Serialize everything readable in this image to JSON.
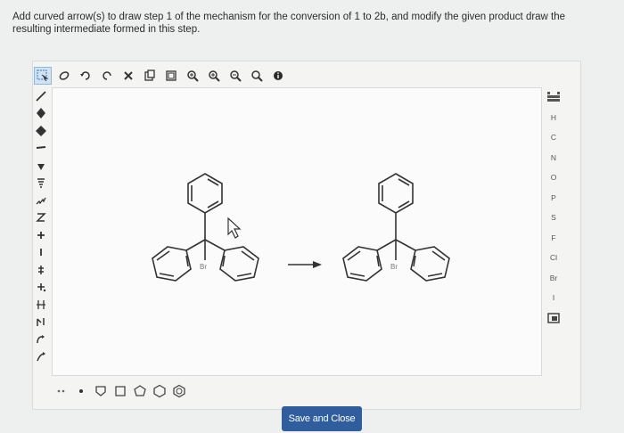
{
  "question": {
    "text": "Add curved arrow(s) to draw step 1 of the mechanism for the conversion of 1 to 2b, and modify the given product draw the resulting intermediate formed in this step."
  },
  "toolbar": {
    "tools": [
      {
        "name": "select-tool",
        "glyph": "⬚",
        "active": true
      },
      {
        "name": "eraser-icon",
        "glyph": "⌀"
      },
      {
        "name": "undo-icon",
        "glyph": "↶"
      },
      {
        "name": "redo-icon",
        "glyph": "↷"
      },
      {
        "name": "delete-icon",
        "glyph": "✕"
      },
      {
        "name": "copy-icon",
        "glyph": "⧉"
      },
      {
        "name": "paste-icon",
        "glyph": "⧉"
      },
      {
        "name": "zoom-in-icon",
        "glyph": "⊕"
      },
      {
        "name": "zoom-fit-icon",
        "glyph": "⊕"
      },
      {
        "name": "zoom-out-icon",
        "glyph": "⊖"
      },
      {
        "name": "zoom-reset-icon",
        "glyph": "⊙"
      },
      {
        "name": "info-icon",
        "glyph": "●"
      }
    ]
  },
  "left_tools": [
    {
      "name": "single-bond-tool",
      "glyph": "╱"
    },
    {
      "name": "double-bond-tool",
      "glyph": "◆"
    },
    {
      "name": "triple-bond-tool",
      "glyph": "◆"
    },
    {
      "name": "chain-tool",
      "glyph": "▬"
    },
    {
      "name": "wedge-bond-tool",
      "glyph": "▲"
    },
    {
      "name": "hash-bond-tool",
      "glyph": "≡"
    },
    {
      "name": "wavy-bond-tool",
      "glyph": "∿"
    },
    {
      "name": "charge-tool",
      "glyph": "Z"
    },
    {
      "name": "plus-charge-tool",
      "glyph": "+"
    },
    {
      "name": "minus-charge-tool",
      "glyph": "−"
    },
    {
      "name": "lone-pair-tool",
      "glyph": "⁝"
    },
    {
      "name": "radical-tool",
      "glyph": "⁚"
    },
    {
      "name": "electron-pair-tool",
      "glyph": "⁝"
    },
    {
      "name": "curved-arrow-double-tool",
      "glyph": "↰"
    },
    {
      "name": "curved-arrow-single-tool",
      "glyph": "↱"
    },
    {
      "name": "reaction-arrow-tool",
      "glyph": "⤴"
    }
  ],
  "elements": [
    "H",
    "C",
    "N",
    "O",
    "P",
    "S",
    "F",
    "Cl",
    "Br",
    "I"
  ],
  "canvas": {
    "reactant_label": "Br",
    "product_label": "Br"
  },
  "save_button": {
    "label": "Save and Close"
  }
}
